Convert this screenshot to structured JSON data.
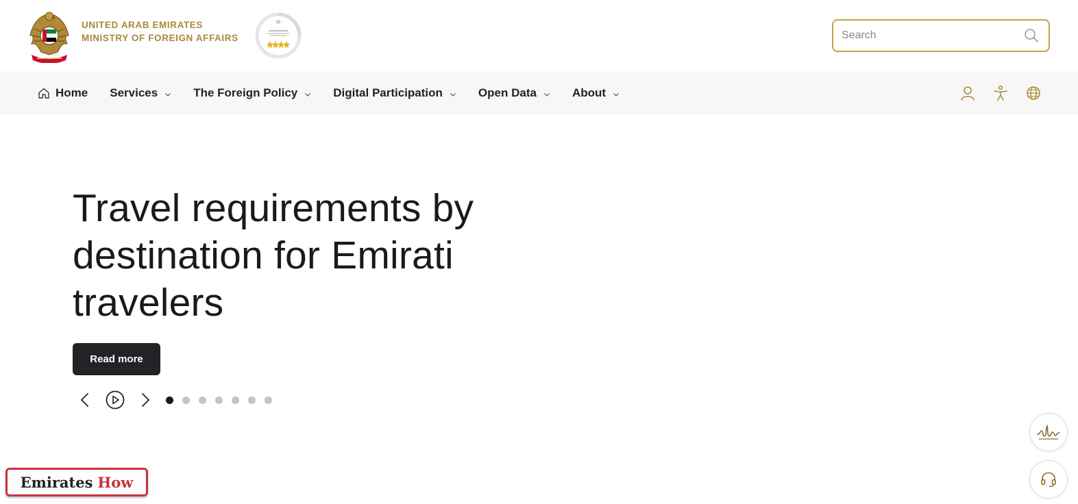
{
  "header": {
    "ministry_line1": "UNITED ARAB EMIRATES",
    "ministry_line2": "MINISTRY OF FOREIGN AFFAIRS",
    "search_placeholder": "Search",
    "accent_color": "#c2a249",
    "icons": [
      "uae-emblem-icon",
      "award-badge-icon",
      "search-icon"
    ]
  },
  "nav": {
    "items": [
      {
        "label": "Home",
        "icon": "home-icon",
        "has_dropdown": false
      },
      {
        "label": "Services",
        "has_dropdown": true
      },
      {
        "label": "The Foreign Policy",
        "has_dropdown": true
      },
      {
        "label": "Digital Participation",
        "has_dropdown": true
      },
      {
        "label": "Open Data",
        "has_dropdown": true
      },
      {
        "label": "About",
        "has_dropdown": true
      }
    ],
    "tools": [
      "user-icon",
      "accessibility-icon",
      "globe-icon"
    ]
  },
  "hero": {
    "title": "Travel requirements by destination for Emirati travelers",
    "button_label": "Read more",
    "slides_total": 7,
    "active_slide": 1
  },
  "floating": [
    "sign-language-icon",
    "headset-icon"
  ],
  "watermark": {
    "part1": "Emirates",
    "part2": "How"
  }
}
